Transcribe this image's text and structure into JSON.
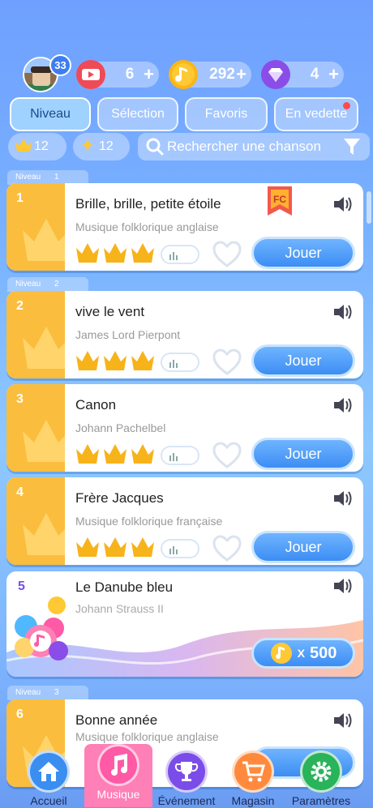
{
  "header": {
    "level_badge": "33",
    "tickets": {
      "value": "6",
      "plus": "+"
    },
    "notes": {
      "value": "292",
      "plus": "+"
    },
    "diamonds": {
      "value": "4",
      "plus": "+"
    }
  },
  "tabs": [
    {
      "label": "Niveau",
      "active": true
    },
    {
      "label": "Sélection",
      "active": false
    },
    {
      "label": "Favoris",
      "active": false
    },
    {
      "label": "En vedette",
      "active": false
    }
  ],
  "filters": {
    "crowns": "12",
    "sparks": "12",
    "search_placeholder": "Rechercher une chanson"
  },
  "levels": [
    {
      "label": "Niveau",
      "number": "1"
    },
    {
      "label": "Niveau",
      "number": "2"
    },
    {
      "label": "Niveau",
      "number": "3"
    }
  ],
  "songs": [
    {
      "number": "1",
      "title": "Brille, brille, petite étoile",
      "artist": "Musique folklorique anglaise",
      "play": "Jouer",
      "badge": "FC"
    },
    {
      "number": "2",
      "title": "vive le vent",
      "artist": "James Lord Pierpont",
      "play": "Jouer"
    },
    {
      "number": "3",
      "title": "Canon",
      "artist": "Johann Pachelbel",
      "play": "Jouer"
    },
    {
      "number": "4",
      "title": "Frère Jacques",
      "artist": "Musique folklorique française",
      "play": "Jouer"
    },
    {
      "number": "5",
      "title": "Le Danube bleu",
      "artist": "Johann Strauss II",
      "price_x": "X",
      "price": "500"
    },
    {
      "number": "6",
      "title": "Bonne année",
      "artist": "Musique folklorique anglaise"
    }
  ],
  "nav": [
    {
      "label": "Accueil",
      "icon": "home-icon",
      "color": "#3a8ef0"
    },
    {
      "label": "Musique",
      "icon": "music-note-icon",
      "color": "#ff5aa5",
      "active": true
    },
    {
      "label": "Événement",
      "icon": "trophy-icon",
      "color": "#7a4de8"
    },
    {
      "label": "Magasin",
      "icon": "cart-icon",
      "color": "#ff8a3d"
    },
    {
      "label": "Paramètres",
      "icon": "gear-icon",
      "color": "#29b35a"
    }
  ]
}
